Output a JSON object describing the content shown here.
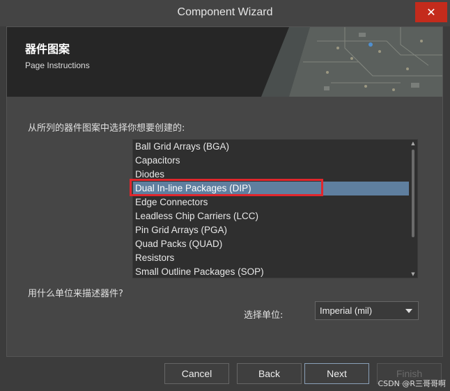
{
  "window": {
    "title": "Component Wizard",
    "close_glyph": "✕"
  },
  "header": {
    "title": "器件图案",
    "subtitle": "Page Instructions"
  },
  "main": {
    "prompt": "从所列的器件图案中选择你想要创建的:",
    "pattern_list": {
      "items": [
        "Ball Grid Arrays (BGA)",
        "Capacitors",
        "Diodes",
        "Dual In-line Packages (DIP)",
        "Edge Connectors",
        "Leadless Chip Carriers (LCC)",
        "Pin Grid Arrays (PGA)",
        "Quad Packs (QUAD)",
        "Resistors",
        "Small Outline Packages (SOP)"
      ],
      "selected": "Dual In-line Packages (DIP)"
    },
    "units_question": "用什么单位来描述器件?",
    "unit_label": "选择单位:",
    "unit_select_value": "Imperial (mil)"
  },
  "footer": {
    "cancel_label": "Cancel",
    "back_label": "Back",
    "next_label": "Next",
    "finish_label": "Finish",
    "watermark": "CSDN @R三哥哥啊"
  },
  "colors": {
    "selection": "#5f7f9f",
    "annotation_box": "#e0262c",
    "close_button": "#c42b1c"
  },
  "icons": {
    "close": "close-icon",
    "dropdown": "chevron-down-icon",
    "scroll_up": "scroll-up-arrow-icon",
    "scroll_down": "scroll-down-arrow-icon"
  }
}
